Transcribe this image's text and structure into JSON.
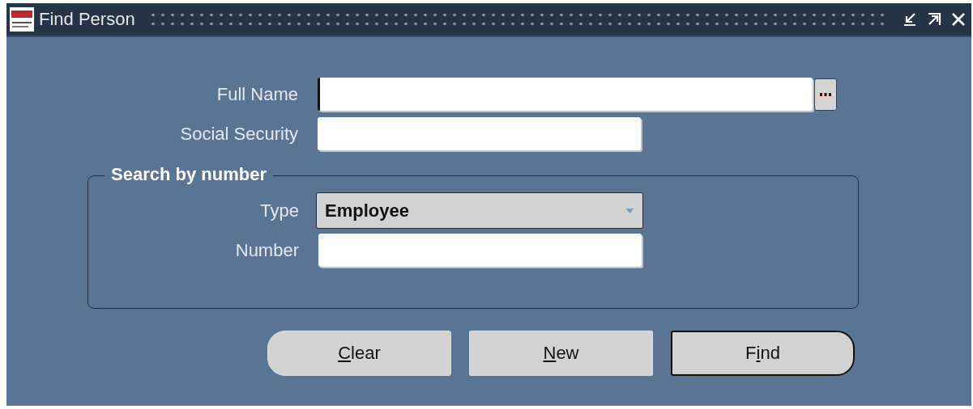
{
  "window": {
    "title": "Find Person"
  },
  "fields": [
    {
      "label": "Full Name",
      "focused": true,
      "lov": true
    },
    {
      "label": "Social Security",
      "focused": false,
      "lov": false
    }
  ],
  "group": {
    "title": "Search by number",
    "type": {
      "label": "Type",
      "value": "Employee"
    },
    "number": {
      "label": "Number"
    }
  },
  "buttons": [
    {
      "mnemonic": "C",
      "rest": "lear",
      "default": false,
      "kind": "left"
    },
    {
      "mnemonic": "N",
      "rest": "ew",
      "default": false,
      "kind": "flat"
    },
    {
      "prefix": "F",
      "mnemonic": "i",
      "rest": "nd",
      "default": true,
      "kind": "right"
    }
  ]
}
